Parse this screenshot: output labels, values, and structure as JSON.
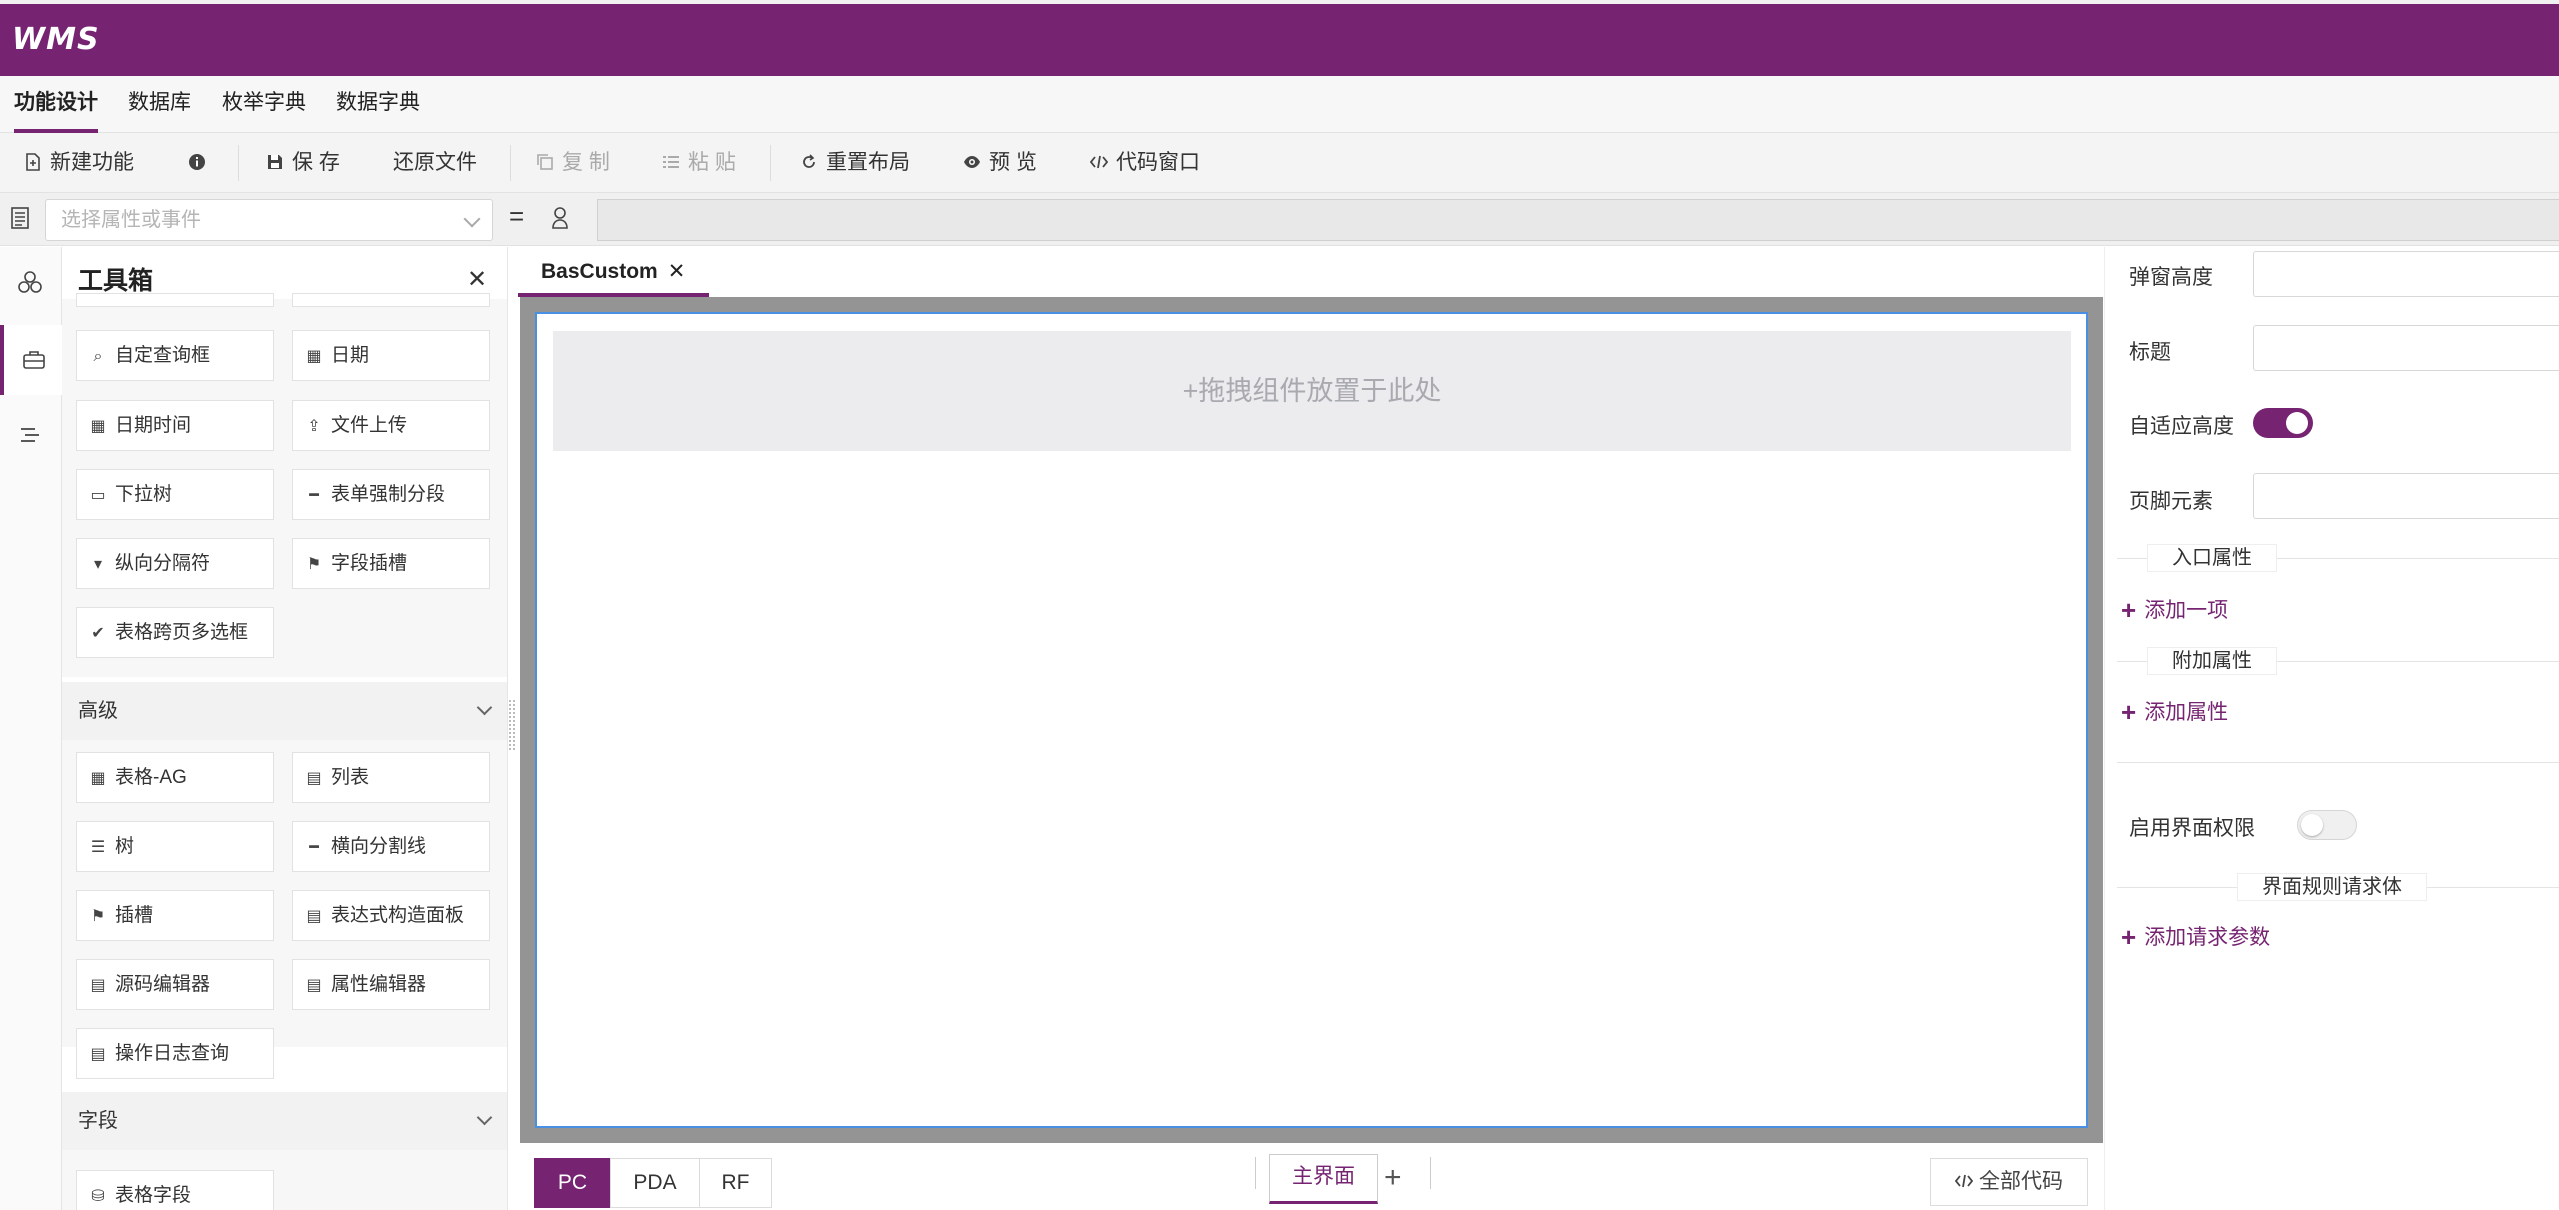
{
  "app": {
    "logo": "WMS",
    "brand_color": "#762472"
  },
  "menu": [
    {
      "label": "功能设计"
    },
    {
      "label": "数据库"
    },
    {
      "label": "枚举字典"
    },
    {
      "label": "数据字典"
    }
  ],
  "toolbar": {
    "new": "新建功能",
    "save": "保 存",
    "restore": "还原文件",
    "copy": "复 制",
    "paste": "粘 贴",
    "reset_layout": "重置布局",
    "preview": "预 览",
    "code_window": "代码窗口"
  },
  "propbar": {
    "placeholder": "选择属性或事件",
    "equals": "="
  },
  "toolbox": {
    "title": "工具箱",
    "basic_items": [
      "自定查询框",
      "日期",
      "日期时间",
      "文件上传",
      "下拉树",
      "表单强制分段",
      "纵向分隔符",
      "字段插槽",
      "表格跨页多选框"
    ],
    "advanced_title": "高级",
    "advanced_items": [
      "表格-AG",
      "列表",
      "树",
      "横向分割线",
      "插槽",
      "表达式构造面板",
      "源码编辑器",
      "属性编辑器",
      "操作日志查询"
    ],
    "fields_title": "字段",
    "fields_items": [
      "表格字段"
    ]
  },
  "editor": {
    "tab": "BasCustom",
    "dropzone": "+拖拽组件放置于此处",
    "platforms": [
      "PC",
      "PDA",
      "RF"
    ],
    "active_platform": "PC",
    "main_view": "主界面",
    "all_code": "全部代码"
  },
  "properties": {
    "popup_height": "弹窗高度",
    "title": "标题",
    "auto_height": "自适应高度",
    "auto_height_on": true,
    "footer": "页脚元素",
    "entry_props": "入口属性",
    "add_item": "添加一项",
    "extra_props": "附加属性",
    "add_prop": "添加属性",
    "enable_permission": "启用界面权限",
    "enable_permission_on": false,
    "rule_body": "界面规则请求体",
    "add_param": "添加请求参数"
  }
}
